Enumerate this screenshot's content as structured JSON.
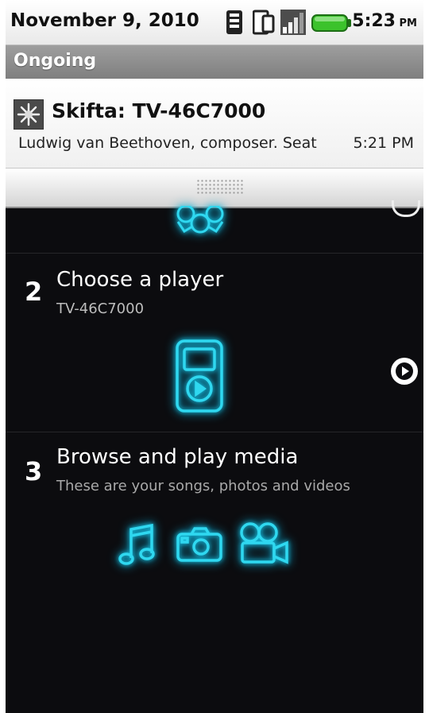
{
  "status_bar": {
    "date": "November 9, 2010",
    "time": "5:23",
    "ampm": "PM",
    "icons": [
      "remote-icon",
      "phone-icon",
      "signal-icon",
      "battery-icon"
    ]
  },
  "notifications": {
    "section_label": "Ongoing",
    "item": {
      "title": "Skifta: TV-46C7000",
      "text": "Ludwig van Beethoven, composer. Seat",
      "time": "5:21 PM"
    }
  },
  "steps": [
    {
      "number": "2",
      "title": "Choose a player",
      "subtitle": "TV-46C7000"
    },
    {
      "number": "3",
      "title": "Browse and play media",
      "subtitle": "These are your songs, photos and videos"
    }
  ],
  "colors": {
    "accent_glow": "#18c8e8",
    "background": "#0c0c0f"
  }
}
